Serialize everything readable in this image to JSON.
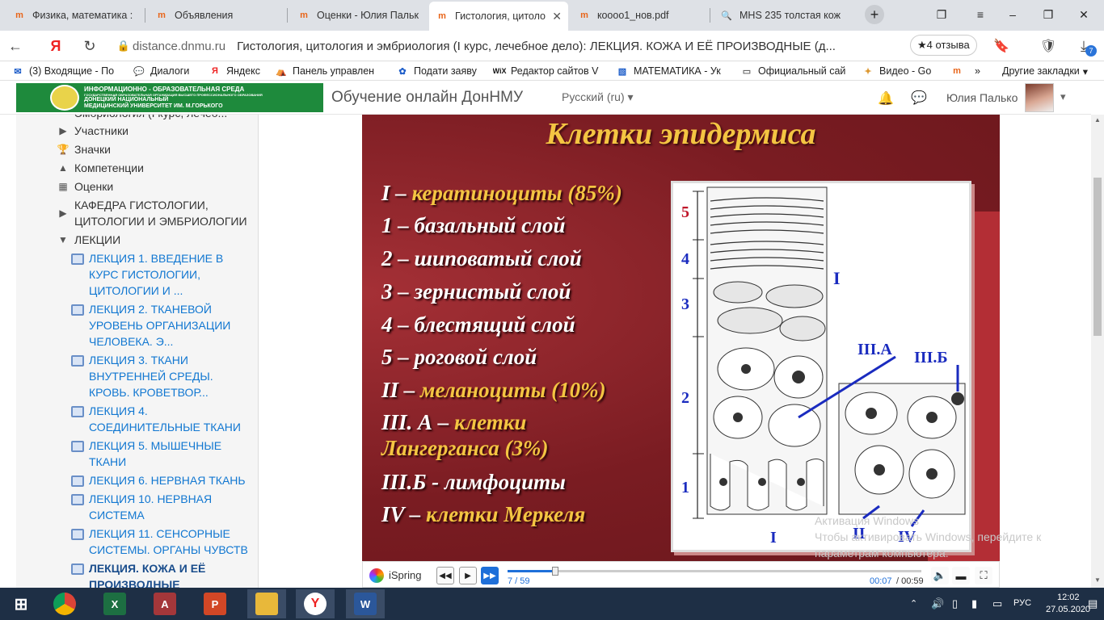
{
  "browser": {
    "tabs": [
      {
        "title": "Физика, математика :",
        "icon": "moodle-icon"
      },
      {
        "title": "Объявления",
        "icon": "moodle-icon"
      },
      {
        "title": "Оценки - Юлия Пальк",
        "icon": "moodle-icon"
      },
      {
        "title": "Гистология, цитоло",
        "icon": "moodle-icon",
        "active": true
      },
      {
        "title": "кoooo1_нов.pdf",
        "icon": "moodle-icon"
      },
      {
        "title": "MHS 235 толстая кож",
        "icon": "search-icon"
      }
    ],
    "new_tab": "+",
    "url_domain": "distance.dnmu.ru",
    "page_title": "Гистология, цитология и эмбриология (I курс, лечебное дело): ЛЕКЦИЯ. КОЖА И ЕЁ ПРОИЗВОДНЫЕ (д...",
    "reviews": "★4 отзыва",
    "download_badge": "7",
    "bookmarks": [
      "(3) Входящие - По",
      "Диалоги",
      "Яндекс",
      "Панель управлен",
      "Подати заяву",
      "Редактор сайтов V",
      "МАТЕМАТИКА - Ук",
      "Официальный сай",
      "Видео - Go",
      "»",
      "Другие закладки"
    ]
  },
  "site": {
    "logo_line1": "ИНФОРМАЦИОННО - ОБРАЗОВАТЕЛЬНАЯ СРЕДА",
    "logo_line2": "ГОСУДАРСТВЕННАЯ ОБРАЗОВАТЕЛЬНАЯ ОРГАНИЗАЦИЯ ВЫСШЕГО ПРОФЕССИОНАЛЬНОГО ОБРАЗОВАНИЯ",
    "logo_line3": "ДОНЕЦКИЙ НАЦИОНАЛЬНЫЙ",
    "logo_line4": "МЕДИЦИНСКИЙ УНИВЕРСИТЕТ ИМ. М.ГОРЬКОГО",
    "name": "Обучение онлайн ДонНМУ",
    "language": "Русский (ru)",
    "user": "Юлия Палько"
  },
  "sidebar": {
    "top_cut": "Эмбриология (I курс, лечеб...",
    "items": [
      {
        "label": "Участники",
        "icon": "triangle-right-icon"
      },
      {
        "label": "Значки",
        "icon": "trophy-icon"
      },
      {
        "label": "Компетенции",
        "icon": "competency-icon"
      },
      {
        "label": "Оценки",
        "icon": "table-icon"
      }
    ],
    "department": "КАФЕДРА ГИСТОЛОГИИ, ЦИТОЛОГИИ И ЭМБРИОЛОГИИ",
    "lectures_label": "ЛЕКЦИИ",
    "lectures": [
      "ЛЕКЦИЯ 1. ВВЕДЕНИЕ В КУРС ГИСТОЛОГИИ, ЦИТОЛОГИИ И ...",
      "ЛЕКЦИЯ 2. ТКАНЕВОЙ УРОВЕНЬ ОРГАНИЗАЦИИ ЧЕЛОВЕКА. Э...",
      "ЛЕКЦИЯ 3. ТКАНИ ВНУТРЕННЕЙ СРЕДЫ. КРОВЬ. КРОВЕТВОР...",
      "ЛЕКЦИЯ 4. СОЕДИНИТЕЛЬНЫЕ ТКАНИ",
      "ЛЕКЦИЯ 5. МЫШЕЧНЫЕ ТКАНИ",
      "ЛЕКЦИЯ 6. НЕРВНАЯ ТКАНЬ",
      "ЛЕКЦИЯ 10. НЕРВНАЯ СИСТЕМА",
      "ЛЕКЦИЯ 11. СЕНСОРНЫЕ СИСТЕМЫ. ОРГАНЫ ЧУВСТВ",
      "ЛЕКЦИЯ. КОЖА И ЕЁ ПРОИЗВОДНЫЕ"
    ]
  },
  "slide": {
    "title": "Клетки эпидермиса",
    "lines": [
      {
        "a": "I – ",
        "b": "кератиноциты (85%)"
      },
      {
        "a": "1 – базальный слой",
        "b": ""
      },
      {
        "a": "2 – шиповатый слой",
        "b": ""
      },
      {
        "a": "3 – зернистый слой",
        "b": ""
      },
      {
        "a": "4 – блестящий слой",
        "b": ""
      },
      {
        "a": "5 – роговой слой",
        "b": ""
      },
      {
        "a": "II – ",
        "b": "меланоциты (10%)"
      },
      {
        "a": "III. А – ",
        "b": "клетки"
      },
      {
        "a": "",
        "b": "Лангерганса (3%)"
      },
      {
        "a": "III.Б - лимфоциты",
        "b": ""
      },
      {
        "a": "IV – ",
        "b": "клетки Меркеля"
      }
    ],
    "diagram_labels": {
      "n5": "5",
      "n4": "4",
      "n3": "3",
      "n2": "2",
      "n1": "1",
      "I_top": "I",
      "I_bottom": "I",
      "IIIA": "III.A",
      "IIIB": "III.Б",
      "II": "II",
      "IV": "IV"
    }
  },
  "player": {
    "brand": "iSpring",
    "slide_counter": "7 / 59",
    "elapsed": "00:07",
    "total": "/ 00:59",
    "progress": 0.115
  },
  "watermark": {
    "line1": "Активация Windows",
    "line2": "Чтобы активировать Windows, перейдите к",
    "line3": "параметрам компьютера."
  },
  "taskbar": {
    "lang": "РУС",
    "time": "12:02",
    "date": "27.05.2020"
  }
}
